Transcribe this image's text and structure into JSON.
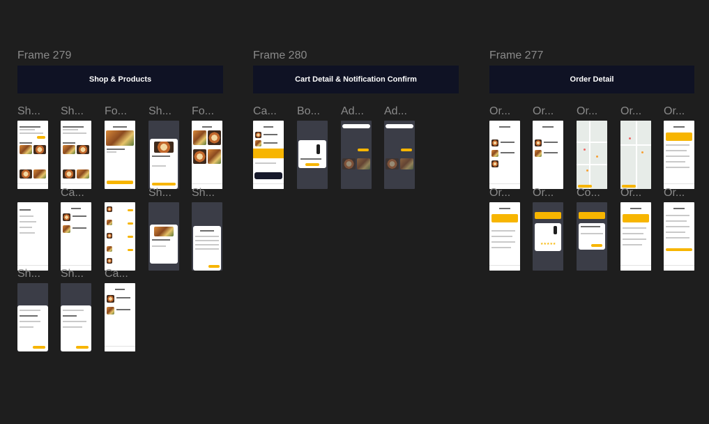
{
  "frames": [
    {
      "label": "Frame 279",
      "title": "Shop & Products"
    },
    {
      "label": "Frame 280",
      "title": "Cart Detail & Notification Confirm"
    },
    {
      "label": "Frame 277",
      "title": "Order Detail"
    }
  ],
  "screen_labels": {
    "f279_r1": [
      "Sh...",
      "Sh...",
      "Fo...",
      "Sh...",
      "Fo..."
    ],
    "f279_r2": [
      "Ca...",
      "Sh..."
    ],
    "f279_r3": [
      "Sh...",
      "Sh...",
      "Ca..."
    ],
    "f280_r1": [
      "Ca...",
      "Bo...",
      "Ad...",
      "Ad..."
    ],
    "f277_r1": [
      "Or...",
      "Or...",
      "Or...",
      "Or...",
      "Or..."
    ],
    "f277_r2": [
      "Or...",
      "Or...",
      "Co...",
      "Or...",
      "Or..."
    ]
  },
  "colors": {
    "canvas": "#1e1e1e",
    "banner": "#0f1224",
    "accent": "#f7b500",
    "label": "#8a8a8a"
  }
}
